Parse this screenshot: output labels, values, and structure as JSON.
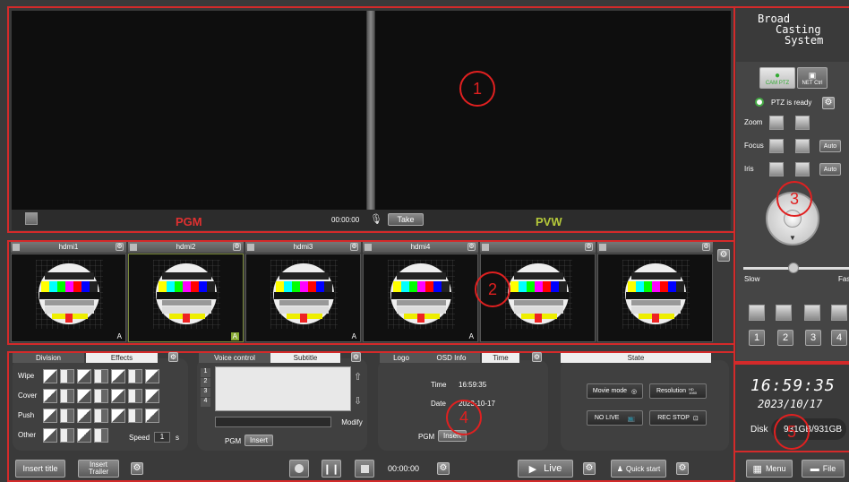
{
  "monitors": {
    "pgm_label": "PGM",
    "pvw_label": "PVW",
    "time": "00:00:00",
    "take": "Take"
  },
  "logo": {
    "line1": "Broad",
    "line2": "Casting",
    "line3": "System"
  },
  "ptz": {
    "cam_ptz": "CAM PTZ",
    "net_ctrl": "NET Ctrl",
    "status": "PTZ is ready",
    "zoom": "Zoom",
    "focus": "Focus",
    "iris": "Iris",
    "auto": "Auto",
    "slow": "Slow",
    "fast": "Fas",
    "numbers": [
      "1",
      "2",
      "3",
      "4"
    ]
  },
  "inputs": [
    {
      "name": "hdmi1",
      "badge": "A"
    },
    {
      "name": "hdmi2",
      "badge": "A"
    },
    {
      "name": "hdmi3",
      "badge": "A"
    },
    {
      "name": "hdmi4",
      "badge": "A"
    },
    {
      "name": "",
      "badge": ""
    },
    {
      "name": "",
      "badge": ""
    }
  ],
  "effects": {
    "tabs": [
      "Division",
      "Effects"
    ],
    "rows": [
      "Wipe",
      "Cover",
      "Push",
      "Other"
    ],
    "speed_label": "Speed",
    "speed_value": "1",
    "speed_unit": "s"
  },
  "voice": {
    "tabs": [
      "Voice control",
      "Subtitle"
    ],
    "lines": [
      "1",
      "2",
      "3",
      "4"
    ],
    "modify": "Modify",
    "pgm": "PGM",
    "insert": "Insert"
  },
  "info": {
    "tabs": [
      "Logo",
      "OSD Info",
      "Time"
    ],
    "time_label": "Time",
    "time_value": "16:59:35",
    "date_label": "Date",
    "date_value": "2023-10-17",
    "pgm": "PGM",
    "insert": "Insert"
  },
  "state": {
    "title": "State",
    "movie": "Movie mode",
    "resolution": "Resolution",
    "res_badge": "HD 1080",
    "nolive": "NO LIVE",
    "recstop": "REC STOP"
  },
  "clock": {
    "time": "16:59:35",
    "date": "2023/10/17",
    "disk_label": "Disk",
    "disk_value": "931GB/931GB"
  },
  "bottom": {
    "insert_title": "Insert title",
    "insert_trailer": "Insert Trailer",
    "rec_time": "00:00:00",
    "live": "Live",
    "quick": "Quick start",
    "menu": "Menu",
    "file": "File"
  },
  "annotations": [
    "1",
    "2",
    "3",
    "4",
    "5"
  ],
  "colors": {
    "pgm": "#e03030",
    "pvw": "#b5c93a",
    "annotation": "#e02020"
  }
}
